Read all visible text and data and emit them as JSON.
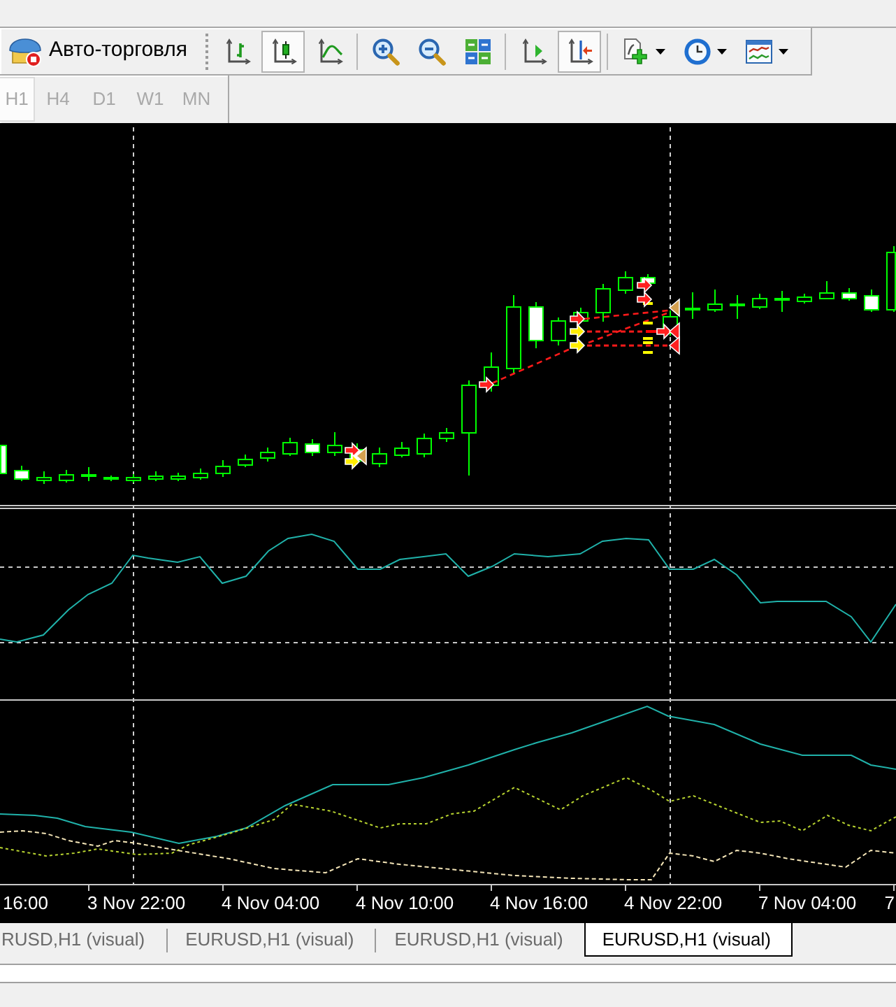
{
  "toolbar": {
    "autotrading": {
      "label": "Авто-торговля"
    },
    "groups": [
      [
        {
          "kind": "bar-chart",
          "pressed": false
        },
        {
          "kind": "candlesticks",
          "pressed": true
        },
        {
          "kind": "line-chart",
          "pressed": false
        }
      ],
      [
        {
          "kind": "zoom-in",
          "pressed": false
        },
        {
          "kind": "zoom-out",
          "pressed": false
        },
        {
          "kind": "tile-windows",
          "pressed": false
        }
      ],
      [
        {
          "kind": "chart-shift",
          "pressed": false
        },
        {
          "kind": "autoscroll",
          "pressed": true
        }
      ],
      [
        {
          "kind": "indicators",
          "pressed": false
        },
        {
          "kind": "periods",
          "pressed": false
        },
        {
          "kind": "templates",
          "pressed": false
        }
      ]
    ]
  },
  "timeframes": [
    {
      "label": "H1",
      "selected": true,
      "disabled": true
    },
    {
      "label": "H4",
      "selected": false,
      "disabled": true
    },
    {
      "label": "D1",
      "selected": false,
      "disabled": true
    },
    {
      "label": "W1",
      "selected": false,
      "disabled": true
    },
    {
      "label": "MN",
      "selected": false,
      "disabled": true
    }
  ],
  "chart": {
    "time_axis": {
      "labels": [
        "16:00",
        "3 Nov 22:00",
        "4 Nov 04:00",
        "4 Nov 10:00",
        "4 Nov 16:00",
        "4 Nov 22:00",
        "7 Nov 04:00",
        "7"
      ]
    }
  },
  "tabs": [
    {
      "label": "RUSD,H1 (visual)",
      "selected": false
    },
    {
      "label": "EURUSD,H1 (visual)",
      "selected": false
    },
    {
      "label": "EURUSD,H1 (visual)",
      "selected": false
    },
    {
      "label": "EURUSD,H1 (visual)",
      "selected": true
    }
  ]
}
